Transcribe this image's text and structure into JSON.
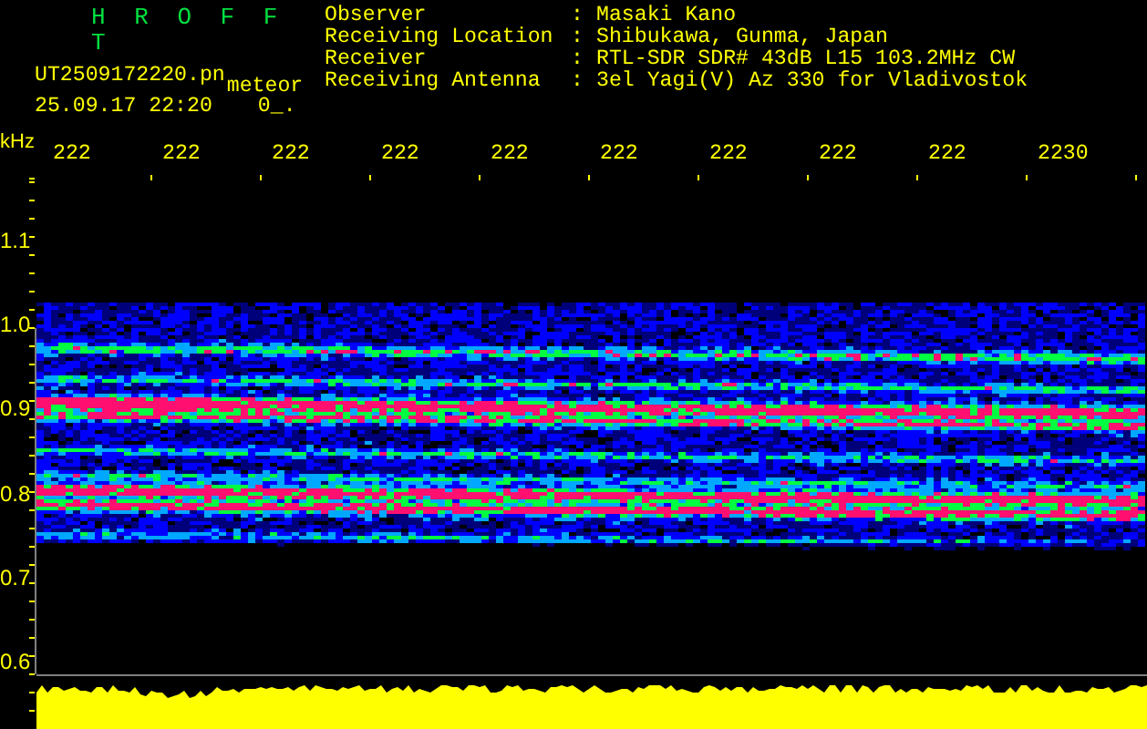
{
  "header": {
    "program_title": "H R O F F T",
    "file_name": "UT2509172220.pn",
    "mode": "meteor",
    "date_time": "25.09.17 22:20",
    "status": "0_."
  },
  "station_info": [
    {
      "label": "Observer",
      "separator": ":",
      "value": "Masaki Kano"
    },
    {
      "label": "Receiving Location",
      "separator": ":",
      "value": "Shibukawa, Gunma, Japan"
    },
    {
      "label": "Receiver",
      "separator": ":",
      "value": "RTL-SDR SDR# 43dB L15 103.2MHz CW"
    },
    {
      "label": "Receiving Antenna",
      "separator": ":",
      "value": "3el Yagi(V) Az 330 for Vladivostok"
    }
  ],
  "time_axis": {
    "labels": [
      "222",
      "222",
      "222",
      "222",
      "222",
      "222",
      "222",
      "222",
      "222",
      "2230"
    ]
  },
  "frequency_axis": {
    "unit": "kHz",
    "labels": [
      "1.1",
      "1.0",
      "0.9",
      "0.8",
      "0.7",
      "0.6"
    ]
  }
}
